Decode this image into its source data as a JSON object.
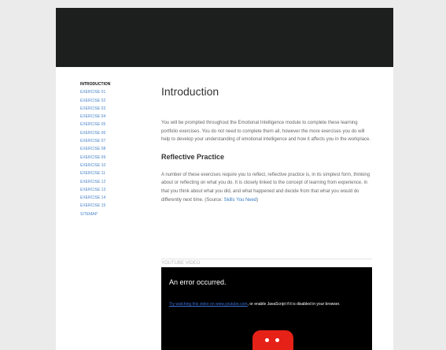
{
  "sidebar": {
    "items": [
      {
        "label": "INTRODUCTION",
        "active": true
      },
      {
        "label": "EXERCISE 01"
      },
      {
        "label": "EXERCISE 02"
      },
      {
        "label": "EXERCISE 03"
      },
      {
        "label": "EXERCISE 04"
      },
      {
        "label": "EXERCISE 05"
      },
      {
        "label": "EXERCISE 06"
      },
      {
        "label": "EXERCISE 07"
      },
      {
        "label": "EXERCISE 08"
      },
      {
        "label": "EXERCISE 09"
      },
      {
        "label": "EXERCISE 10"
      },
      {
        "label": "EXERCISE 11"
      },
      {
        "label": "EXERCISE 12"
      },
      {
        "label": "EXERCISE 13"
      },
      {
        "label": "EXERCISE 14"
      },
      {
        "label": "EXERCISE 15"
      },
      {
        "label": "SITEMAP"
      }
    ]
  },
  "main": {
    "title": "Introduction",
    "intro_paragraph": "You will be prompted throughout the Emotional Intelligence module to complete these learning portfolio exercises. You do not need to complete them all, however the more exercises you do will help to develop your understanding of emotional intelligence and how it affects you in the workplace.",
    "section_heading": "Reflective Practice",
    "reflective_paragraph": "A number of these exercises require you to reflect, reflective practice is, in its simplest form, thinking about or reflecting on what you do.  It is closely linked to the concept of learning from experience, in that you think about what you did, and what happened and decide from that what you would do differently next time. (Source: ",
    "source_link": "Skills You Need",
    "source_close": ")"
  },
  "video": {
    "label": "YOUTUBE VIDEO",
    "error_title": "An error occurred.",
    "link_text": "Try watching this video on www.youtube.com",
    "message_rest": ", or enable JavaScript if it is disabled in your browser."
  },
  "colors": {
    "header": "#1c1f1e",
    "link": "#4a86c8",
    "youtube_red": "#e62117"
  }
}
